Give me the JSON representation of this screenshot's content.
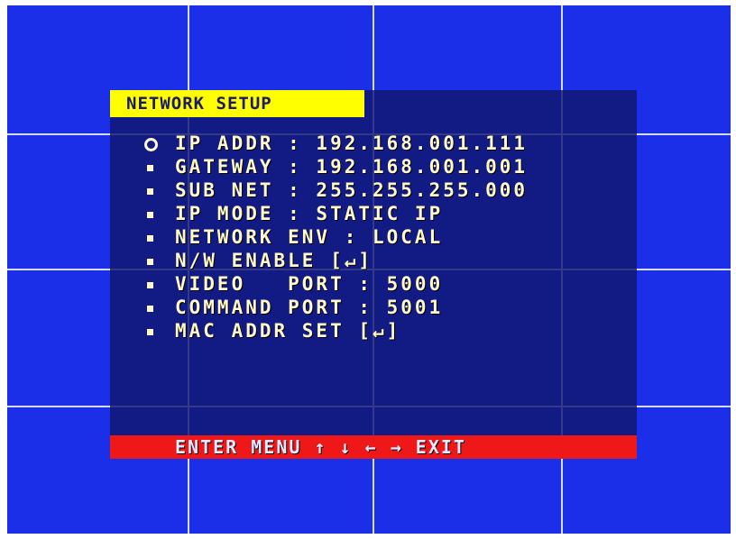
{
  "osd": {
    "title": "NETWORK SETUP",
    "items": [
      {
        "label": "IP ADDR : 192.168.001.111",
        "marker": "circle"
      },
      {
        "label": "GATEWAY : 192.168.001.001",
        "marker": "bullet"
      },
      {
        "label": "SUB NET : 255.255.255.000",
        "marker": "bullet"
      },
      {
        "label": "IP MODE : STATIC IP",
        "marker": "bullet"
      },
      {
        "label": "NETWORK ENV : LOCAL",
        "marker": "bullet"
      },
      {
        "label": "N/W ENABLE [↵]",
        "marker": "bullet"
      },
      {
        "label": "VIDEO   PORT : 5000",
        "marker": "bullet"
      },
      {
        "label": "COMMAND PORT : 5001",
        "marker": "bullet"
      },
      {
        "label": "MAC ADDR SET [↵]",
        "marker": "bullet"
      }
    ],
    "footer": "ENTER MENU ↑ ↓ ← → EXIT"
  },
  "colors": {
    "screen_bg": "#1c2fe8",
    "title_bg": "#ffff00",
    "footer_bg": "#ee1818",
    "text": "#fff8c8"
  }
}
